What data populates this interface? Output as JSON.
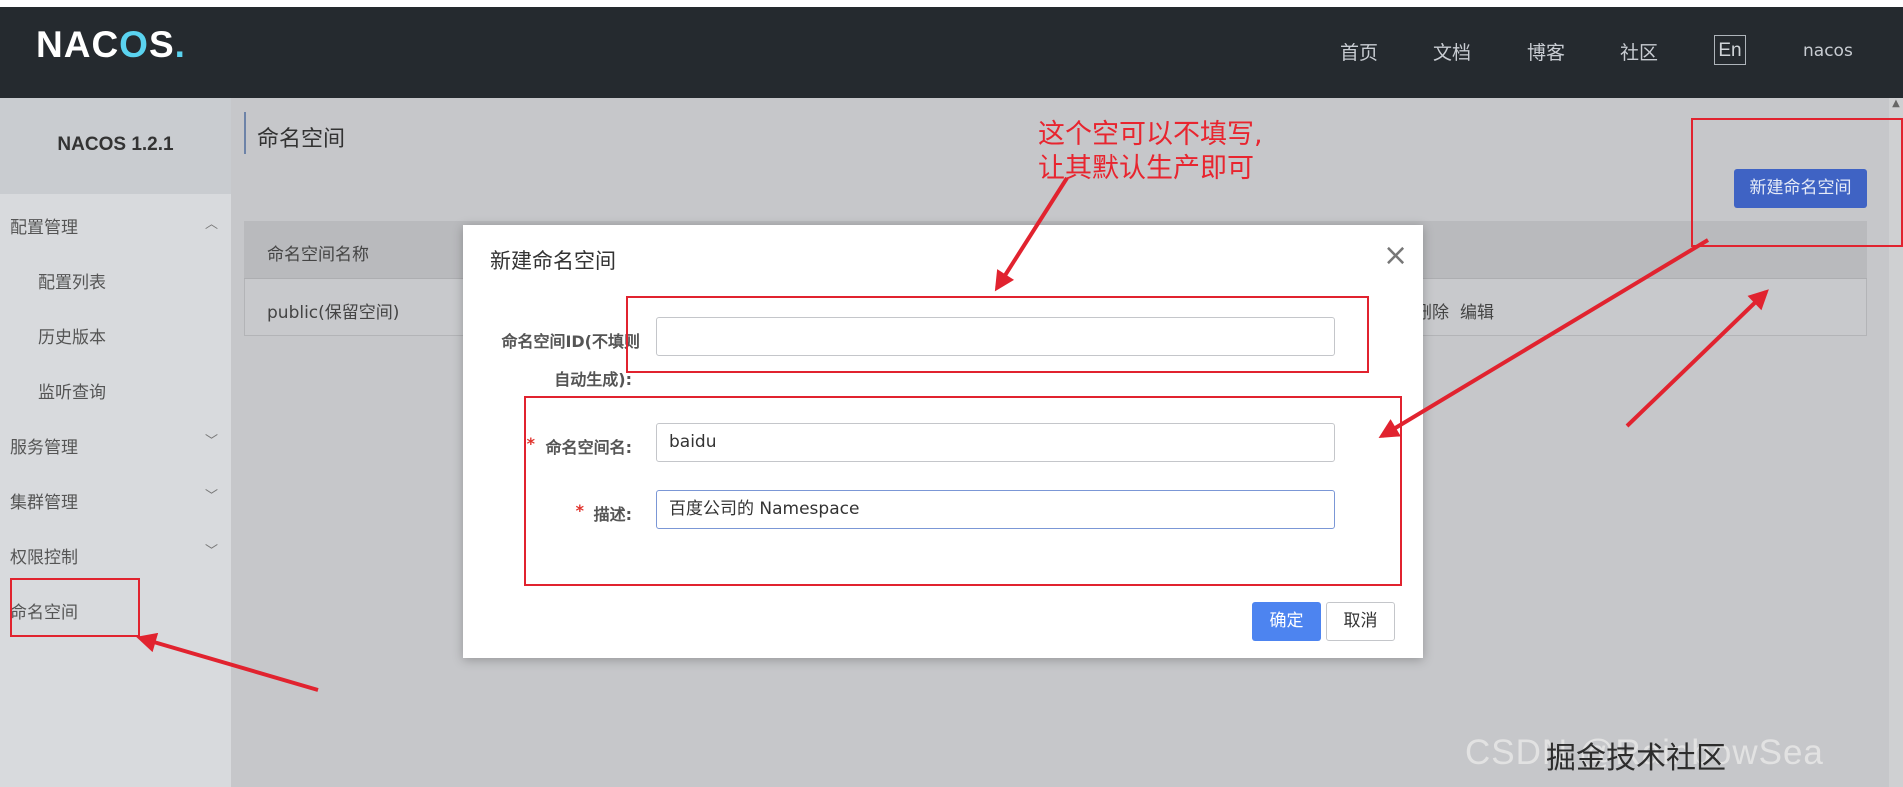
{
  "header": {
    "logo_text": "NACOS.",
    "nav": [
      "首页",
      "文档",
      "博客",
      "社区"
    ],
    "lang": "En",
    "user": "nacos"
  },
  "sidebar": {
    "title": "NACOS 1.2.1",
    "items": [
      {
        "label": "配置管理",
        "chevron": "up"
      },
      {
        "label": "配置列表"
      },
      {
        "label": "历史版本"
      },
      {
        "label": "监听查询"
      },
      {
        "label": "服务管理",
        "chevron": "down"
      },
      {
        "label": "集群管理",
        "chevron": "down"
      },
      {
        "label": "权限控制",
        "chevron": "down"
      },
      {
        "label": "命名空间"
      }
    ]
  },
  "main": {
    "title": "命名空间",
    "new_button": "新建命名空间",
    "table": {
      "header": "命名空间名称",
      "row_name": "public(保留空间)",
      "op_delete": "删除",
      "op_edit": "编辑"
    }
  },
  "dialog": {
    "title": "新建命名空间",
    "id_label_line1": "命名空间ID(不填则",
    "id_label_line2": "自动生成):",
    "id_value": "",
    "name_label": "命名空间名:",
    "name_value": "baidu",
    "desc_label": "描述:",
    "desc_value": "百度公司的 Namespace",
    "required_mark": "*",
    "ok": "确定",
    "cancel": "取消",
    "close_symbol": "×"
  },
  "annotation": {
    "line1": "这个空可以不填写,",
    "line2": "让其默认生产即可"
  },
  "watermark": {
    "back": "CSDN @RainbowSea",
    "front": "掘金技术社区"
  },
  "colors": {
    "header_bg": "#252a2f",
    "primary": "#4d84f0",
    "annotation_red": "#e1232f"
  }
}
